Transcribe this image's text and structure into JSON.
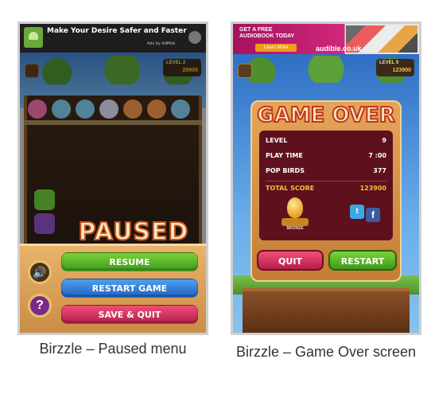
{
  "left_screen": {
    "ad": {
      "headline": "Make Your Desire Safer and Faster",
      "sub": "Ads by AdMob"
    },
    "hud": {
      "level_label": "LEVEL 2",
      "score": "29000"
    },
    "title": "PAUSED",
    "buttons": {
      "resume": "RESUME",
      "restart": "RESTART GAME",
      "save_quit": "SAVE & QUIT"
    },
    "sound_icon": "speaker-icon",
    "help_icon": "?",
    "caption": "Birzzle – Paused menu",
    "bird_colors": [
      "#f070a8",
      "#7fc8e8",
      "#7fc8e8",
      "#d8d8f0",
      "#f0924a",
      "#f0924a",
      "#7fc8e8"
    ]
  },
  "right_screen": {
    "ad": {
      "line1": "GET A FREE",
      "line2": "AUDIOBOOK TODAY",
      "learn": "Learn More",
      "domain": "audible.co.uk"
    },
    "hud": {
      "level_label": "LEVEL 9",
      "score": "123900"
    },
    "title": "GAME OVER",
    "stats": [
      {
        "label": "LEVEL",
        "value": "9"
      },
      {
        "label": "PLAY TIME",
        "value": "7 :00"
      },
      {
        "label": "POP BIRDS",
        "value": "377"
      }
    ],
    "total": {
      "label": "TOTAL SCORE",
      "value": "123900"
    },
    "badge": "BRONZE",
    "social": {
      "twitter": "t",
      "facebook": "f"
    },
    "buttons": {
      "quit": "QUIT",
      "restart": "RESTART"
    },
    "caption": "Birzzle – Game Over screen"
  }
}
